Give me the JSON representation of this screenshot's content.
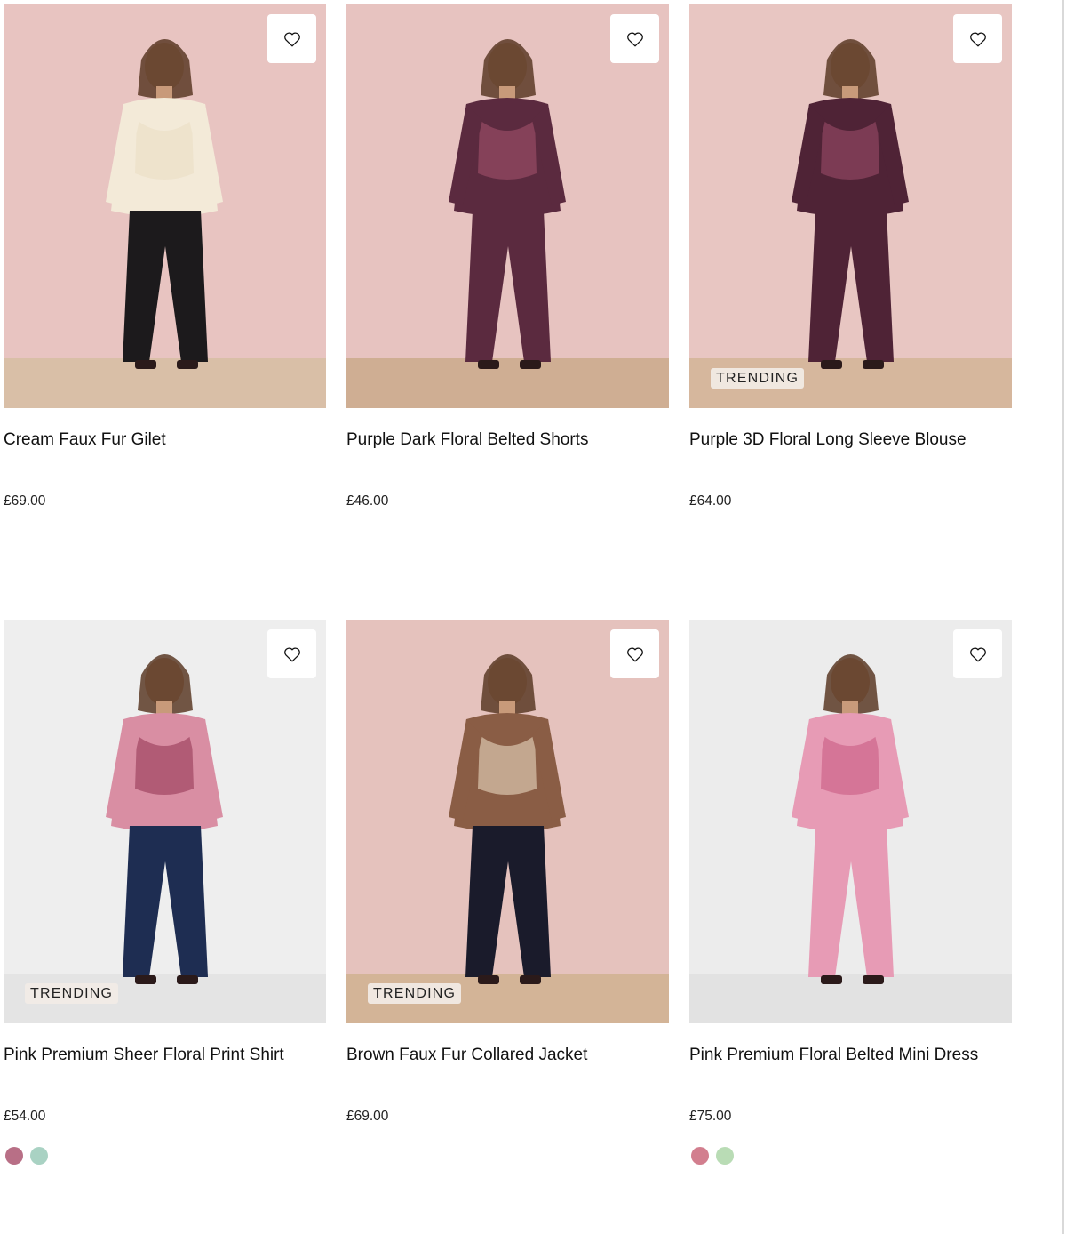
{
  "products": [
    {
      "title": "Cream Faux Fur Gilet",
      "price": "£69.00",
      "badge": "",
      "wishlist_icon": "heart-outline-icon",
      "image": {
        "bg": "#e8c4c1",
        "floor": "#d9bfa7",
        "top": "#f3ead8",
        "bottom": "#1c1a1c",
        "accent": "#e9dcc2"
      }
    },
    {
      "title": "Purple Dark Floral Belted Shorts",
      "price": "£46.00",
      "badge": "",
      "wishlist_icon": "heart-outline-icon",
      "image": {
        "bg": "#e7c3c0",
        "floor": "#cfae93",
        "top": "#5b2a3f",
        "bottom": "#5b2a3f",
        "accent": "#a8546f"
      }
    },
    {
      "title": "Purple 3D Floral Long Sleeve Blouse",
      "price": "£64.00",
      "badge": "TRENDING",
      "wishlist_icon": "heart-outline-icon",
      "image": {
        "bg": "#e8c6c2",
        "floor": "#d6b79d",
        "top": "#4f2336",
        "bottom": "#4f2336",
        "accent": "#a3506d"
      }
    },
    {
      "title": "Pink Premium Sheer Floral Print Shirt",
      "price": "£54.00",
      "badge": "TRENDING",
      "wishlist_icon": "heart-outline-icon",
      "image": {
        "bg": "#eeeeee",
        "floor": "#e4e4e4",
        "top": "#d98ea3",
        "bottom": "#1e2d52",
        "accent": "#8f3150"
      },
      "swatches": [
        "#b86f86",
        "#a9d2c3"
      ]
    },
    {
      "title": "Brown Faux Fur Collared Jacket",
      "price": "£69.00",
      "badge": "TRENDING",
      "wishlist_icon": "heart-outline-icon",
      "image": {
        "bg": "#e5c2bd",
        "floor": "#d3b497",
        "top": "#8a5d45",
        "bottom": "#1a1b2b",
        "accent": "#f2e3cc"
      }
    },
    {
      "title": "Pink Premium Floral Belted Mini Dress",
      "price": "£75.00",
      "badge": "",
      "wishlist_icon": "heart-outline-icon",
      "image": {
        "bg": "#ececec",
        "floor": "#e2e2e2",
        "top": "#e79bb5",
        "bottom": "#e79bb5",
        "accent": "#c7567e"
      },
      "swatches": [
        "#d27e8e",
        "#b9dcb5"
      ]
    }
  ]
}
